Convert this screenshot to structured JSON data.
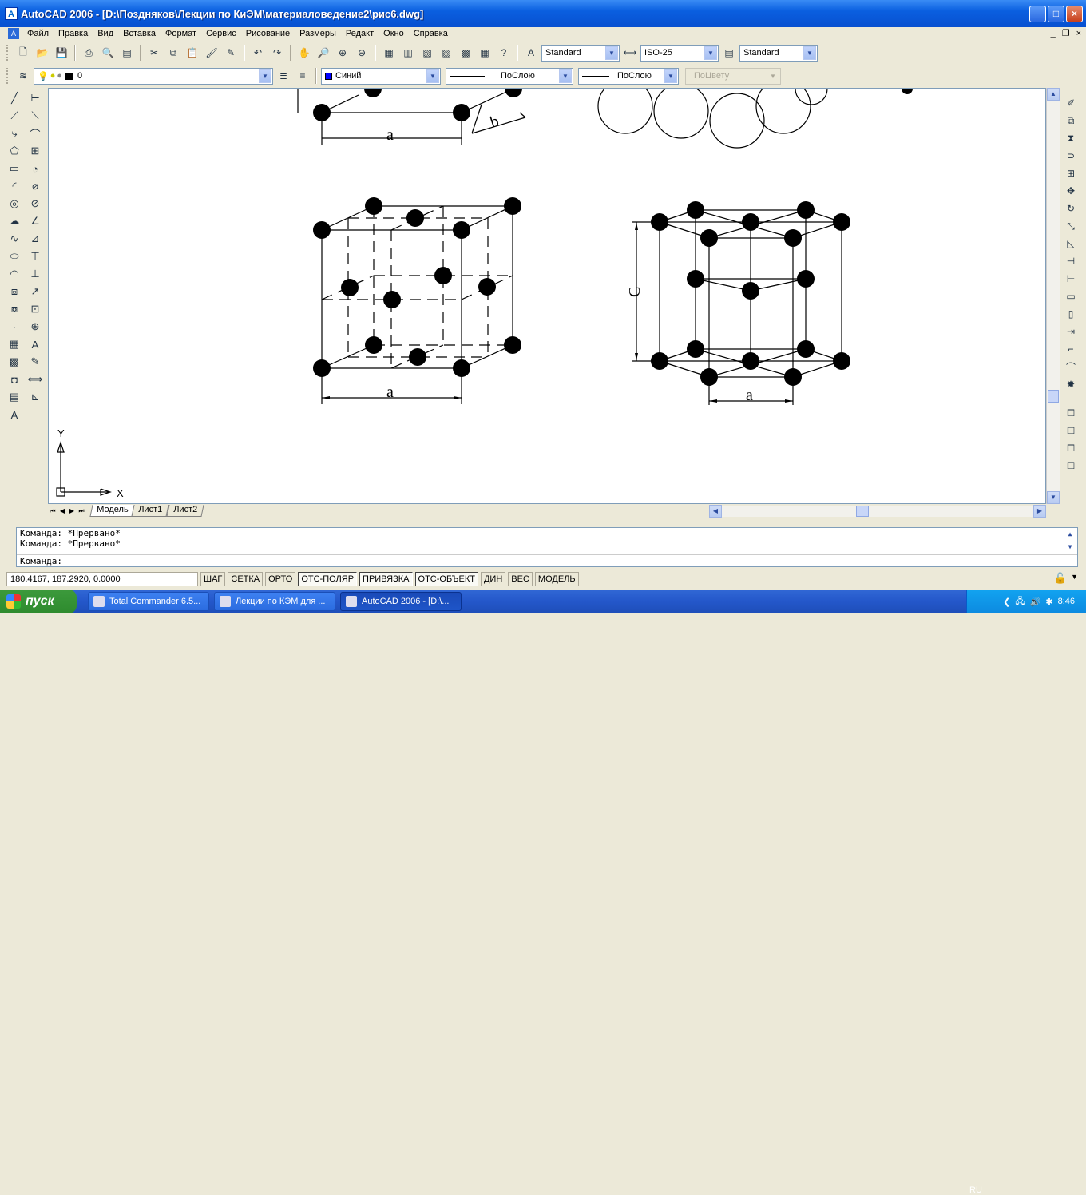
{
  "window": {
    "title": "AutoCAD 2006 - [D:\\Поздняков\\Лекции по КиЭМ\\материаловедение2\\рис6.dwg]",
    "app_icon": "autocad-icon"
  },
  "menu": [
    "Файл",
    "Правка",
    "Вид",
    "Вставка",
    "Формат",
    "Сервис",
    "Рисование",
    "Размеры",
    "Редакт",
    "Окно",
    "Справка"
  ],
  "styles": {
    "text_style": "Standard",
    "dim_style": "ISO-25",
    "table_style": "Standard"
  },
  "layers": {
    "current_layer": "0",
    "color": "Синий",
    "color_hex": "#0000ff",
    "linetype": "ПоСлою",
    "lineweight": "ПоСлою",
    "plotstyle": "ПоЦвету"
  },
  "drawing": {
    "label_a": "a",
    "label_b": "b",
    "label_c": "C",
    "ucs_x": "X",
    "ucs_y": "Y"
  },
  "layout_tabs": [
    "Модель",
    "Лист1",
    "Лист2"
  ],
  "command": {
    "history": [
      "Команда:  *Прервано*",
      "Команда:  *Прервано*"
    ],
    "prompt": "Команда:"
  },
  "status": {
    "coords": "180.4167, 187.2920, 0.0000",
    "toggles": [
      {
        "label": "ШАГ",
        "on": false
      },
      {
        "label": "СЕТКА",
        "on": false
      },
      {
        "label": "ОРТО",
        "on": false
      },
      {
        "label": "ОТС-ПОЛЯР",
        "on": true
      },
      {
        "label": "ПРИВЯЗКА",
        "on": true
      },
      {
        "label": "ОТС-ОБЪЕКТ",
        "on": true
      },
      {
        "label": "ДИН",
        "on": false
      },
      {
        "label": "ВЕС",
        "on": false
      },
      {
        "label": "МОДЕЛЬ",
        "on": false
      }
    ]
  },
  "taskbar": {
    "start": "пуск",
    "tasks": [
      "Total Commander 6.5...",
      "Лекции по КЭМ для ...",
      "AutoCAD 2006 - [D:\\..."
    ],
    "lang": "RU",
    "clock": "8:46"
  }
}
